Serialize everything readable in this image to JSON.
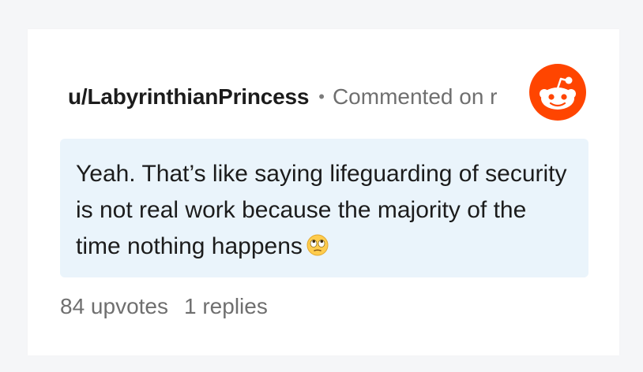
{
  "comment": {
    "username": "u/LabyrinthianPrincess",
    "separator": "•",
    "meta": "Commented on r",
    "body": "Yeah. That’s like saying lifeguarding of security is not real work because the majority of the time nothing happens",
    "emoji_icon": "face-with-rolling-eyes-icon",
    "upvotes_text": "84 upvotes",
    "replies_text": "1 replies"
  },
  "brand": {
    "logo_icon": "reddit-snoo-icon",
    "accent_color": "#ff4500",
    "comment_bg_color": "#eaf4fb"
  }
}
